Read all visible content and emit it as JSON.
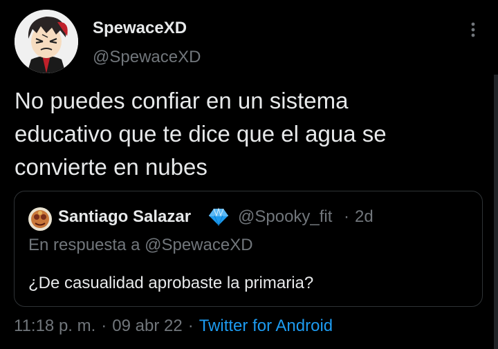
{
  "tweet": {
    "display_name": "SpewaceXD",
    "handle": "@SpewaceXD",
    "text_lines": [
      "No puedes confiar en un sistema",
      "educativo que te dice que el agua se",
      "convierte en nubes"
    ],
    "time": "11:18 p. m.",
    "separator": "·",
    "date": "09 abr 22",
    "source": "Twitter for Android"
  },
  "quoted_tweet": {
    "display_name": "Santiago Salazar",
    "handle": "@Spooky_fit",
    "separator": "·",
    "time_ago": "2d",
    "reply_context": "En respuesta a @SpewaceXD",
    "text": "¿De casualidad aprobaste la primaria?"
  },
  "icons": {
    "more": "more-vertical-icon",
    "verified": "verified-badge-icon"
  },
  "colors": {
    "background": "#000000",
    "primary_text": "#e7e9ea",
    "secondary_text": "#71767b",
    "link": "#1d9bf0",
    "verified": "#1d9bf0",
    "border": "#2f3336"
  }
}
